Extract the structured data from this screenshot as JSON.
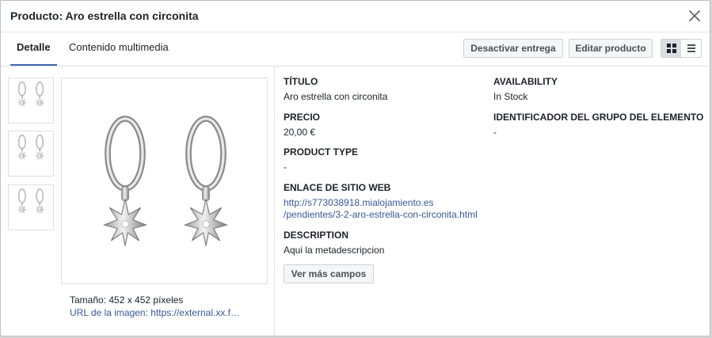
{
  "dialog": {
    "title": "Producto: Aro estrella con circonita"
  },
  "tabs": [
    {
      "label": "Detalle",
      "active": true
    },
    {
      "label": "Contenido multimedia",
      "active": false
    }
  ],
  "actions": {
    "deactivate_label": "Desactivar entrega",
    "edit_label": "Editar producto"
  },
  "view_toggle": {
    "options": [
      "grid-icon",
      "list-icon"
    ],
    "selected": "grid-icon"
  },
  "image": {
    "size_text": "Tamaño: 452 x 452 píxeles",
    "url_prefix": "URL de la imagen: ",
    "url_text": "https://external.xx.f…"
  },
  "fields": {
    "title": {
      "label": "TÍTULO",
      "value": "Aro estrella con circonita"
    },
    "price": {
      "label": "PRECIO",
      "value": "20,00 €"
    },
    "product_type": {
      "label": "PRODUCT TYPE",
      "value": "-"
    },
    "website": {
      "label": "ENLACE DE SITIO WEB",
      "line1": "http://s773038918.mialojamiento.es",
      "line2": "/pendientes/3-2-aro-estrella-con-circonita.html"
    },
    "description": {
      "label": "DESCRIPTION",
      "value": "Aqui la metadescripcion"
    },
    "availability": {
      "label": "AVAILABILITY",
      "value": "In Stock"
    },
    "group_id": {
      "label": "IDENTIFICADOR DEL GRUPO DEL ELEMENTO",
      "value": "-"
    }
  },
  "more_fields_label": "Ver más campos",
  "colors": {
    "accent": "#4267b2",
    "link": "#365899",
    "text": "#1d2129"
  }
}
